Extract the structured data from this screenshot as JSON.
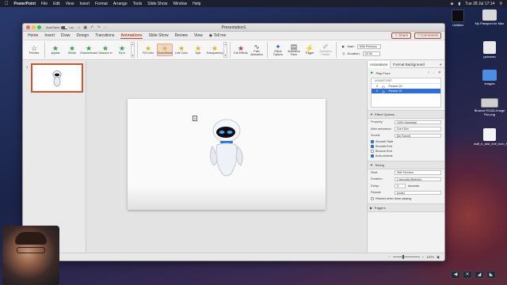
{
  "menubar": {
    "app": "PowerPoint",
    "items": [
      "File",
      "Edit",
      "View",
      "Insert",
      "Format",
      "Arrange",
      "Tools",
      "Slide Show",
      "Window",
      "Help"
    ],
    "clock": "Tue 28 Jul  17:14"
  },
  "desktop": {
    "icons": [
      {
        "label": "Untitled"
      },
      {
        "label": "My Passport for Mac"
      },
      {
        "label": "pptxman"
      },
      {
        "label": "Images"
      },
      {
        "label": "Blusbot ROAD-Image File.png"
      },
      {
        "label": "wall_e_and_eve_icon_by_da...pxrs.png"
      }
    ]
  },
  "window": {
    "title": "Presentation1",
    "autosave_label": "AutoSave",
    "autosave_state": "OFF",
    "tabs": [
      "Home",
      "Insert",
      "Draw",
      "Design",
      "Transitions",
      "Animations",
      "Slide Show",
      "Review",
      "View"
    ],
    "active_tab": "Animations",
    "tell_me": "Tell me",
    "share": "Share",
    "comments": "Comments"
  },
  "ribbon": {
    "preview": "Preview",
    "effects": [
      "Appear",
      "Shrink",
      "Checkerboard",
      "Dissolve In",
      "Fly In",
      "Fill Color",
      "Grow/Shrink",
      "Line Color",
      "Spin",
      "Transparency"
    ],
    "tools": [
      "Exit Effects",
      "Path Animation",
      "Effect Options",
      "Animation Pane",
      "Trigger",
      "Animation Painter"
    ],
    "start_label": "Start:",
    "start_value": "With Previous",
    "duration_label": "Duration:",
    "duration_value": "02.00"
  },
  "slide": {
    "number": "1",
    "label_top": "0",
    "label_bottom": "0"
  },
  "pane": {
    "tabs": [
      "Animations",
      "Format Background"
    ],
    "play_from": "Play From",
    "list_header": "ANIMATIONS",
    "items": [
      {
        "num": "0",
        "name": "Picture 20"
      },
      {
        "num": "0",
        "name": "Picture 22"
      }
    ],
    "effect_options_title": "Effect Options",
    "property_label": "Property:",
    "property_value": "100% Horizontal",
    "after_anim_label": "After animation:",
    "after_anim_value": "Don't Dim",
    "sound_label": "Sound:",
    "sound_value": "[No Sound]",
    "checks": [
      {
        "label": "Smooth Start",
        "on": true
      },
      {
        "label": "Smooth End",
        "on": true
      },
      {
        "label": "Bounce End",
        "on": false
      },
      {
        "label": "Auto-reverse",
        "on": true
      }
    ],
    "timing_title": "Timing",
    "timing_start_label": "Start:",
    "timing_start_value": "With Previous",
    "duration_label": "Duration:",
    "duration_value": "2 seconds (Medium)",
    "delay_label": "Delay:",
    "delay_value": "0",
    "delay_unit": "seconds",
    "repeat_label": "Repeat:",
    "repeat_value": "(none)",
    "rewind_label": "Rewind when done playing",
    "triggers_title": "Triggers"
  },
  "status": {
    "zoom": "100%"
  }
}
